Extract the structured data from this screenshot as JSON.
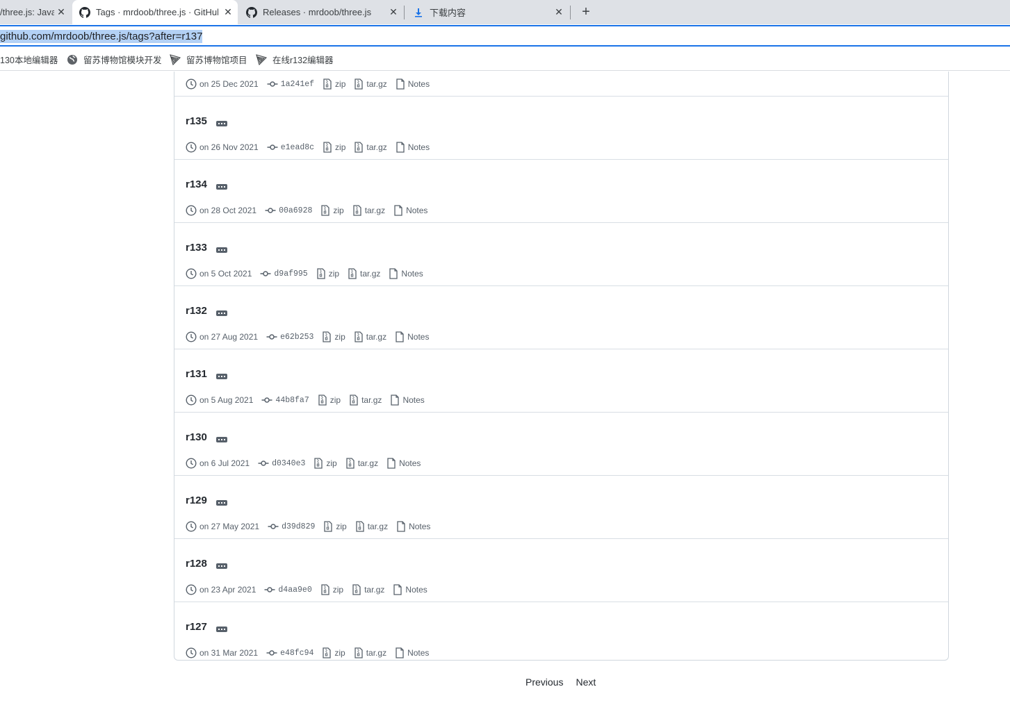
{
  "browser": {
    "tabs": [
      {
        "title": "/three.js: Java",
        "active": false
      },
      {
        "title": "Tags · mrdoob/three.js · GitHub",
        "active": true
      },
      {
        "title": "Releases · mrdoob/three.js",
        "active": false
      },
      {
        "title": "下载内容",
        "active": false
      }
    ],
    "url": "github.com/mrdoob/three.js/tags?after=r137",
    "bookmarks": [
      {
        "label": "130本地编辑器"
      },
      {
        "label": "留苏博物馆模块开发"
      },
      {
        "label": "留苏博物馆项目"
      },
      {
        "label": "在线r132编辑器"
      }
    ]
  },
  "partial_row": {
    "date": "on 25 Dec 2021",
    "sha": "1a241ef",
    "zip": "zip",
    "tar": "tar.gz",
    "notes": "Notes"
  },
  "tags": [
    {
      "name": "r135",
      "date": "on 26 Nov 2021",
      "sha": "e1ead8c",
      "zip": "zip",
      "tar": "tar.gz",
      "notes": "Notes"
    },
    {
      "name": "r134",
      "date": "on 28 Oct 2021",
      "sha": "00a6928",
      "zip": "zip",
      "tar": "tar.gz",
      "notes": "Notes"
    },
    {
      "name": "r133",
      "date": "on 5 Oct 2021",
      "sha": "d9af995",
      "zip": "zip",
      "tar": "tar.gz",
      "notes": "Notes"
    },
    {
      "name": "r132",
      "date": "on 27 Aug 2021",
      "sha": "e62b253",
      "zip": "zip",
      "tar": "tar.gz",
      "notes": "Notes"
    },
    {
      "name": "r131",
      "date": "on 5 Aug 2021",
      "sha": "44b8fa7",
      "zip": "zip",
      "tar": "tar.gz",
      "notes": "Notes"
    },
    {
      "name": "r130",
      "date": "on 6 Jul 2021",
      "sha": "d0340e3",
      "zip": "zip",
      "tar": "tar.gz",
      "notes": "Notes"
    },
    {
      "name": "r129",
      "date": "on 27 May 2021",
      "sha": "d39d829",
      "zip": "zip",
      "tar": "tar.gz",
      "notes": "Notes"
    },
    {
      "name": "r128",
      "date": "on 23 Apr 2021",
      "sha": "d4aa9e0",
      "zip": "zip",
      "tar": "tar.gz",
      "notes": "Notes"
    },
    {
      "name": "r127",
      "date": "on 31 Mar 2021",
      "sha": "e48fc94",
      "zip": "zip",
      "tar": "tar.gz",
      "notes": "Notes"
    }
  ],
  "pagination": {
    "previous": "Previous",
    "next": "Next"
  }
}
